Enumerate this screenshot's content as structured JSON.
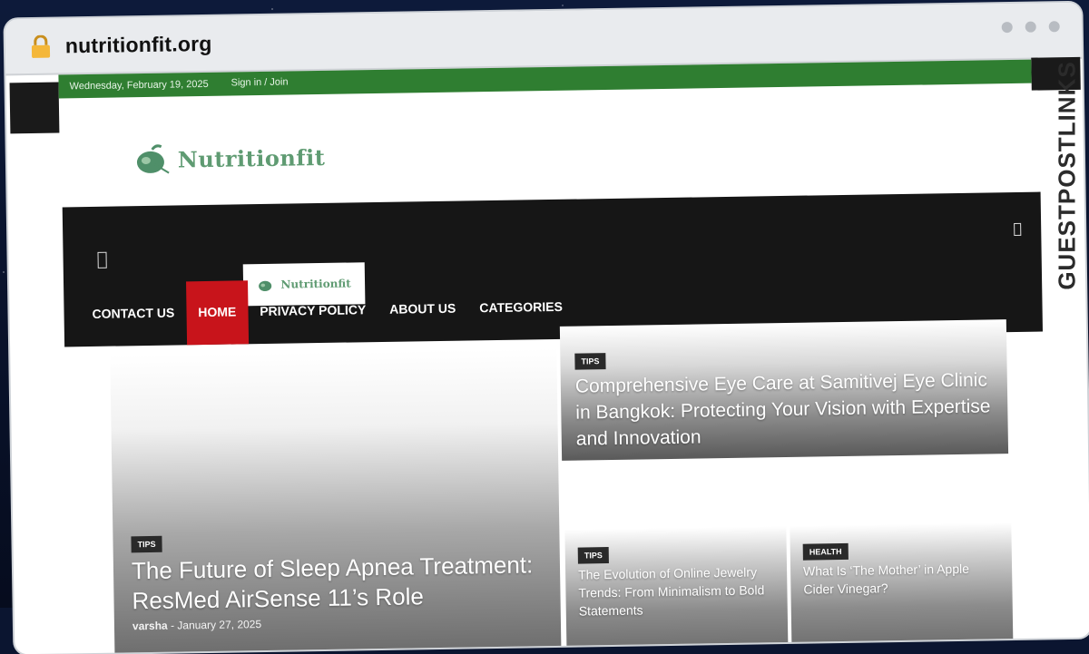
{
  "browser": {
    "url": "nutritionfit.org"
  },
  "topbar": {
    "date": "Wednesday, February 19, 2025",
    "sign_in": "Sign in / Join"
  },
  "site": {
    "logo_text": "Nutritionfit"
  },
  "nav": {
    "items": [
      {
        "label": "CONTACT US",
        "active": false
      },
      {
        "label": "HOME",
        "active": true
      },
      {
        "label": "PRIVACY POLICY",
        "active": false
      },
      {
        "label": "ABOUT US",
        "active": false
      },
      {
        "label": "CATEGORIES",
        "active": false
      }
    ],
    "logo_text": "Nutritionfit"
  },
  "featured": {
    "hero": {
      "category": "TIPS",
      "title": "The Future of Sleep Apnea Treatment: ResMed AirSense 11’s Role",
      "author": "varsha",
      "date": "January 27, 2025"
    },
    "top": {
      "category": "TIPS",
      "title": "Comprehensive Eye Care at Samitivej Eye Clinic in Bangkok: Protecting Your Vision with Expertise and Innovation"
    },
    "small_a": {
      "category": "TIPS",
      "title": "The Evolution of Online Jewelry Trends: From Minimalism to Bold Statements"
    },
    "small_b": {
      "category": "HEALTH",
      "title": "What Is ‘The Mother’ in Apple Cider Vinegar?"
    }
  },
  "watermark": {
    "text": "GUESTPOSTLINKS"
  },
  "colors": {
    "topbar": "#2f7e31",
    "nav_bg": "#161616",
    "nav_active": "#c8141b",
    "logo": "#5f9b72",
    "lock": "#f4b73a"
  },
  "icons": [
    "lock-icon",
    "menu-icon",
    "search-icon",
    "logo-icon"
  ]
}
